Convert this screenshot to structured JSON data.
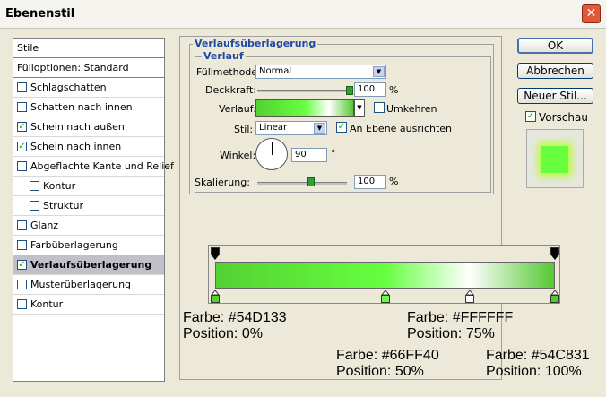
{
  "window": {
    "title": "Ebenenstil"
  },
  "left_list": {
    "header": "Stile",
    "fill_options": "Fülloptionen: Standard",
    "items": [
      {
        "label": "Schlagschatten",
        "checked": false,
        "indent": false
      },
      {
        "label": "Schatten nach innen",
        "checked": false,
        "indent": false
      },
      {
        "label": "Schein nach außen",
        "checked": true,
        "indent": false
      },
      {
        "label": "Schein nach innen",
        "checked": true,
        "indent": false
      },
      {
        "label": "Abgeflachte Kante und Relief",
        "checked": false,
        "indent": false
      },
      {
        "label": "Kontur",
        "checked": false,
        "indent": true
      },
      {
        "label": "Struktur",
        "checked": false,
        "indent": true
      },
      {
        "label": "Glanz",
        "checked": false,
        "indent": false
      },
      {
        "label": "Farbüberlagerung",
        "checked": false,
        "indent": false
      },
      {
        "label": "Verlaufsüberlagerung",
        "checked": true,
        "indent": false,
        "selected": true
      },
      {
        "label": "Musterüberlagerung",
        "checked": false,
        "indent": false
      },
      {
        "label": "Kontur",
        "checked": false,
        "indent": false
      }
    ]
  },
  "panel": {
    "title": "Verlaufsüberlagerung",
    "section": "Verlauf",
    "blend_label": "Füllmethode:",
    "blend_value": "Normal",
    "opacity_label": "Deckkraft:",
    "opacity_value": "100",
    "opacity_unit": "%",
    "opacity_level": 1.0,
    "gradient_label": "Verlauf:",
    "reverse_label": "Umkehren",
    "reverse_checked": false,
    "style_label": "Stil:",
    "style_value": "Linear",
    "align_label": "An Ebene ausrichten",
    "align_checked": true,
    "angle_label": "Winkel:",
    "angle_value": "90",
    "angle_unit": "°",
    "scale_label": "Skalierung:",
    "scale_value": "100",
    "scale_unit": "%",
    "scale_level": 0.6
  },
  "buttons": {
    "ok": "OK",
    "cancel": "Abbrechen",
    "new_style": "Neuer Stil...",
    "preview_label": "Vorschau",
    "preview_checked": true
  },
  "gradient": {
    "stops": [
      {
        "color": "#54D133",
        "position": 0
      },
      {
        "color": "#66FF40",
        "position": 50
      },
      {
        "color": "#FFFFFF",
        "position": 75
      },
      {
        "color": "#54C831",
        "position": 100
      }
    ]
  },
  "annotations": {
    "a1": {
      "farbe": "Farbe: #54D133",
      "position": "Position: 0%"
    },
    "a2": {
      "farbe": "Farbe: #FFFFFF",
      "position": "Position: 75%"
    },
    "a3": {
      "farbe": "Farbe: #66FF40",
      "position": "Position: 50%"
    },
    "a4": {
      "farbe": "Farbe: #54C831",
      "position": "Position: 100%"
    }
  },
  "colors": {
    "accent": "#1f48a8",
    "selected_row": "#c0c0c8",
    "close": "#e0583a"
  }
}
